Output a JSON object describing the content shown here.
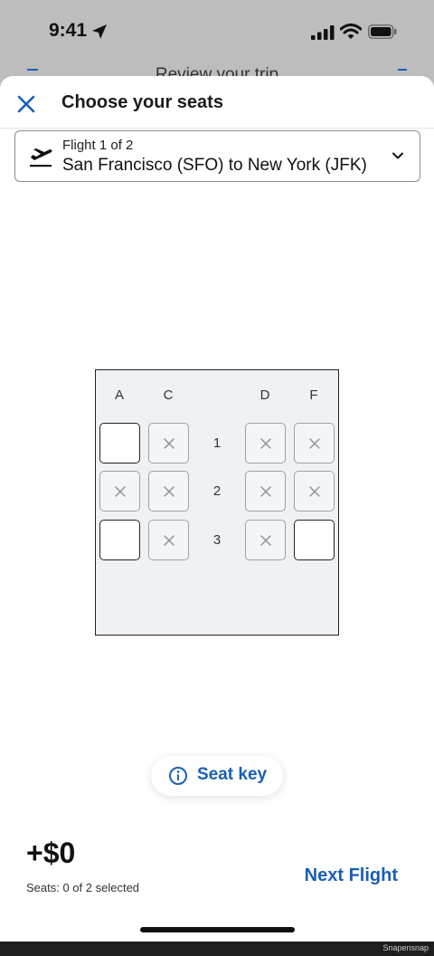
{
  "status_bar": {
    "time": "9:41"
  },
  "background_screen": {
    "title": "Review your trip"
  },
  "sheet": {
    "title": "Choose your seats",
    "flight_selector": {
      "flight_count": "Flight 1 of 2",
      "route": "San Francisco (SFO) to New York (JFK)"
    },
    "seat_map": {
      "columns": [
        "A",
        "C",
        "D",
        "F"
      ],
      "rows": [
        {
          "number": "1",
          "seats": [
            "available",
            "unavailable",
            "unavailable",
            "unavailable"
          ]
        },
        {
          "number": "2",
          "seats": [
            "unavailable",
            "unavailable",
            "unavailable",
            "unavailable"
          ]
        },
        {
          "number": "3",
          "seats": [
            "available",
            "unavailable",
            "unavailable",
            "available"
          ]
        }
      ]
    },
    "seat_key_label": "Seat key",
    "footer": {
      "price": "+$0",
      "seats_selected": "Seats: 0 of 2 selected",
      "next_button": "Next Flight"
    }
  },
  "watermark": "Snapensnap",
  "colors": {
    "accent": "#1a5fb4",
    "seat_map_bg": "#eff2f5"
  }
}
